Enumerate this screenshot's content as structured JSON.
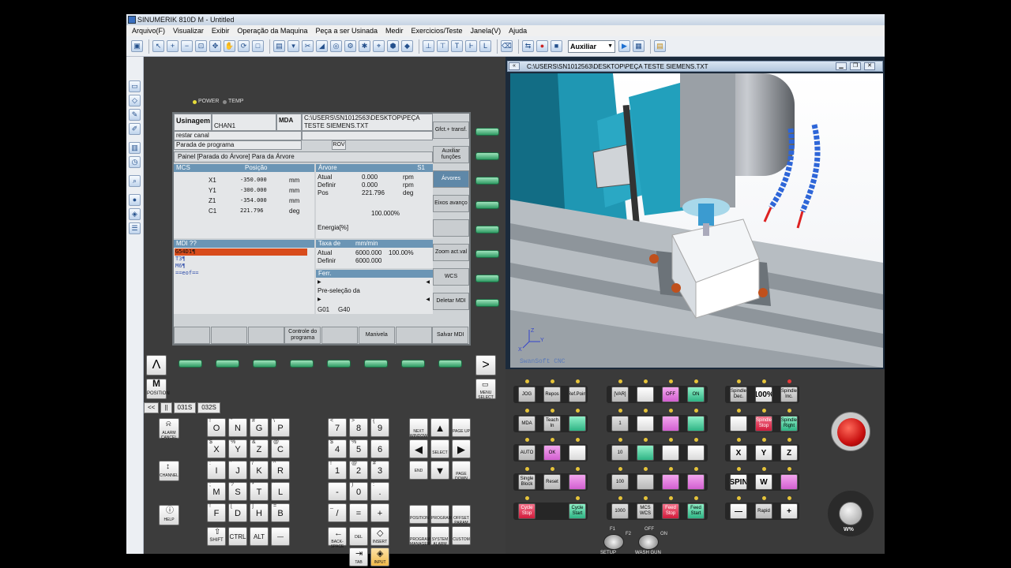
{
  "window": {
    "title": "SINUMERIK 810D M - Untitled"
  },
  "menu": [
    "Arquivo(F)",
    "Visualizar",
    "Exibir",
    "Operação da Maquina",
    "Peça a ser Usinada",
    "Medir",
    "Exercicios/Teste",
    "Janela(V)",
    "Ajuda"
  ],
  "toolbar": {
    "mode_select_value": "Auxiliar"
  },
  "status_leds": {
    "power": "POWER",
    "temp": "TEMP"
  },
  "screen": {
    "area": "Usinagem",
    "channel": "CHAN1",
    "mode": "MDA",
    "path": "C:\\USERS\\SN1012563\\DESKTOP\\PEÇA TESTE SIEMENS.TXT",
    "channel_status": "restar canal",
    "program_status": "Parada de programa",
    "rov": "ROV",
    "panel_title": "Painel [Parada do Árvore] Para da Árvore",
    "mcs_header": "MCS",
    "position_header": "Posição",
    "axes": [
      {
        "name": "X1",
        "value": "-350.000",
        "unit": "mm"
      },
      {
        "name": "Y1",
        "value": "-300.000",
        "unit": "mm"
      },
      {
        "name": "Z1",
        "value": "-354.000",
        "unit": "mm"
      },
      {
        "name": "C1",
        "value": "221.796",
        "unit": "deg"
      }
    ],
    "spindle": {
      "header": "Árvore",
      "id": "S1",
      "rows": [
        {
          "label": "Atual",
          "value": "0.000",
          "unit": "rpm"
        },
        {
          "label": "Definir",
          "value": "0.000",
          "unit": "rpm"
        },
        {
          "label": "Pos",
          "value": "221.796",
          "unit": "deg"
        }
      ],
      "percent": "100.000%",
      "energy": "Energia[%]"
    },
    "mdi": {
      "header": "MDI ??",
      "lines": [
        "G54D1¶",
        "T3¶",
        "M6¶",
        "==eof=="
      ]
    },
    "feed": {
      "header": "Taxa de",
      "unit": "mm/min",
      "rows": [
        {
          "label": "Atual",
          "value": "6000.000",
          "extra": "100.00%"
        },
        {
          "label": "Definir",
          "value": "6000.000",
          "extra": ""
        }
      ]
    },
    "tool": {
      "header": "Ferr.",
      "preselect": "Pre-seleção da",
      "gcodes": [
        "G01",
        "G40"
      ]
    },
    "vertical_softkeys": [
      "Gfct.+ transf.",
      "Auxiliar funções",
      "Árvores",
      "Eixos avanço",
      "",
      "Zoom act.val",
      "WCS",
      "Deletar MDI"
    ],
    "horizontal_softkeys": [
      "",
      "",
      "",
      "Controle do programa",
      "",
      "Manivela",
      "",
      "Salvar MDI"
    ]
  },
  "panel": {
    "recall": "Λ",
    "next": ">",
    "position_key": "POSITION",
    "menu_select": "MENU SELECT",
    "channel_tabs": [
      "<<",
      "||",
      "031S",
      "032S"
    ],
    "side_keys": [
      "ALARM CANCEL",
      "CHANNEL",
      "HELP"
    ],
    "letter_rows": [
      [
        {
          "main": "O",
          "sub": "!"
        },
        {
          "main": "N",
          "sub": "\""
        },
        {
          "main": "G",
          "sub": "#"
        },
        {
          "main": "P",
          "sub": "\\"
        }
      ],
      [
        {
          "main": "X",
          "sub": "$"
        },
        {
          "main": "Y",
          "sub": "%"
        },
        {
          "main": "Z",
          "sub": "&"
        },
        {
          "main": "C",
          "sub": "@"
        }
      ],
      [
        {
          "main": "I",
          "sub": ":"
        },
        {
          "main": "J",
          "sub": "'"
        },
        {
          "main": "K",
          "sub": "/"
        },
        {
          "main": "R",
          "sub": "^"
        }
      ],
      [
        {
          "main": "M",
          "sub": ";"
        },
        {
          "main": "S",
          "sub": "?"
        },
        {
          "main": "T",
          "sub": "*"
        },
        {
          "main": "L",
          "sub": "`"
        }
      ],
      [
        {
          "main": "F",
          "sub": "!"
        },
        {
          "main": "D",
          "sub": "["
        },
        {
          "main": "H",
          "sub": "]"
        },
        {
          "main": "B",
          "sub": "="
        }
      ]
    ],
    "bottom_keys": [
      "SHIFT",
      "CTRL",
      "ALT",
      "—"
    ],
    "num_rows": [
      [
        {
          "main": "7",
          "sub": "<"
        },
        {
          "main": "8",
          "sub": ">"
        },
        {
          "main": "9",
          "sub": "{"
        }
      ],
      [
        {
          "main": "4",
          "sub": "$"
        },
        {
          "main": "5",
          "sub": "%"
        },
        {
          "main": "6",
          "sub": ""
        }
      ],
      [
        {
          "main": "1",
          "sub": "!"
        },
        {
          "main": "2",
          "sub": "@"
        },
        {
          "main": "3",
          "sub": "#"
        }
      ],
      [
        {
          "main": "-",
          "sub": ""
        },
        {
          "main": "0",
          "sub": ")"
        },
        {
          "main": ".",
          "sub": ":"
        }
      ],
      [
        {
          "main": "/",
          "sub": "_"
        },
        {
          "main": "=",
          "sub": ""
        },
        {
          "main": "+",
          "sub": ""
        }
      ]
    ],
    "edit_keys": [
      "BACK-SPACE",
      "DEL",
      "INSERT",
      "TAB",
      "INPUT"
    ],
    "nav_keys": [
      "NEXT WINDOW",
      "PAGE UP",
      "SELECT",
      "END",
      "PAGE DOWN"
    ],
    "area_keys": [
      "POSITION",
      "PROGRAM",
      "OFFSET PARAM",
      "PROGRAM MANAGER",
      "SYSTEM ALARM",
      "CUSTOM"
    ]
  },
  "view3d": {
    "path": "C:\\USERS\\SN1012563\\DESKTOP\\PEÇA TESTE SIEMENS.TXT",
    "watermark": "SwanSoft CNC",
    "axes": [
      "Z",
      "Y",
      "X"
    ]
  },
  "mcp": {
    "row1": [
      "JOG",
      "Repos",
      "Ref.Point",
      "[VAR]",
      "",
      "OFF",
      "ON",
      "Spindle Dec.",
      "100%",
      "Spindle Inc."
    ],
    "row2": [
      "MDA",
      "Teach In",
      "",
      "1",
      "",
      "",
      "",
      "",
      "Spindle Stop",
      "Spindle Right"
    ],
    "row3": [
      "AUTO",
      "OK",
      "",
      "10",
      "",
      "",
      "",
      "X",
      "Y",
      "Z"
    ],
    "row4": [
      "Single Block",
      "Reset",
      "",
      "100",
      "",
      "",
      "",
      "SPIN",
      "W",
      ""
    ],
    "row5": [
      "Cycle Stop",
      "Cycle Start",
      "1000",
      "MCS WCS",
      "Feed Stop",
      "Feed Start",
      "—",
      "Rapid",
      "+"
    ],
    "switches": [
      {
        "label": "SETUP",
        "top": "F1",
        "side": "F2"
      },
      {
        "label": "WASH GUN",
        "top": "OFF",
        "side": "ON"
      }
    ],
    "dial": "W%"
  }
}
